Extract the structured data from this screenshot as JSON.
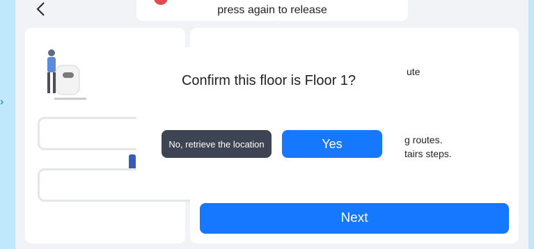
{
  "header": {
    "back_icon": "chevron-left-icon",
    "toast_text": "press again to release"
  },
  "right_panel": {
    "partial_line_1": "ute",
    "partial_line_2": "g routes.",
    "partial_line_3": "tairs steps.",
    "next_label": "Next"
  },
  "dialog": {
    "title": "Confirm this floor is Floor 1?",
    "no_label": "No, retrieve the location",
    "yes_label": "Yes"
  },
  "colors": {
    "background": "#bfe9fb",
    "primary": "#1677ff",
    "secondary_button": "#3e4453",
    "toast_dot": "#e14b4b"
  }
}
